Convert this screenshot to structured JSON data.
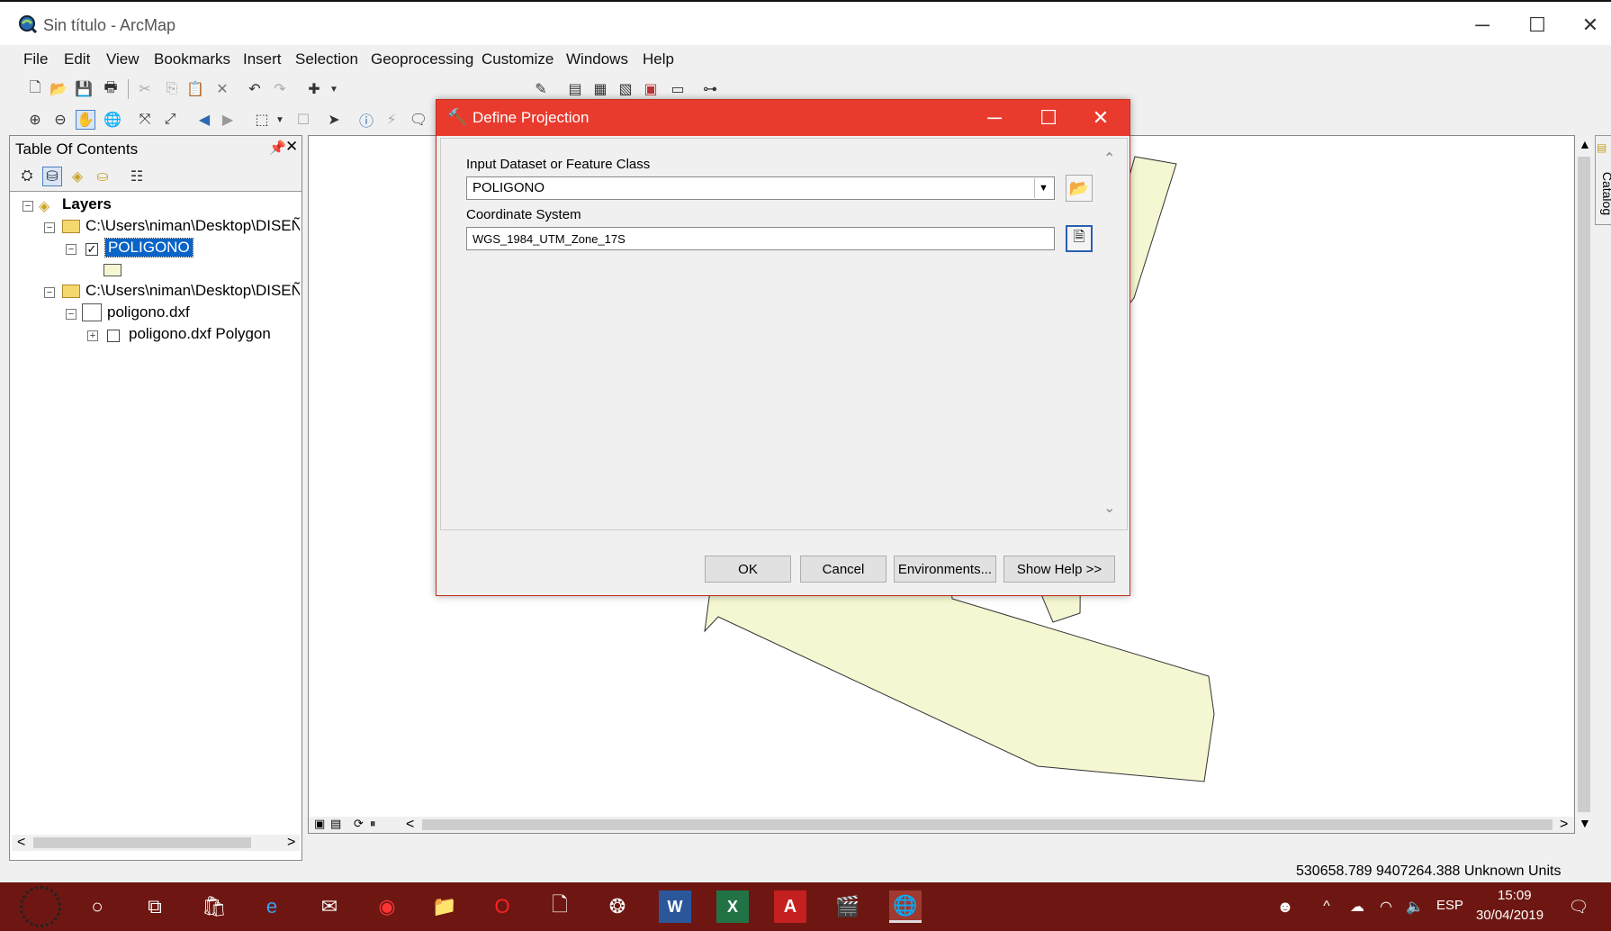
{
  "window": {
    "title": "Sin título - ArcMap"
  },
  "menu": [
    "File",
    "Edit",
    "View",
    "Bookmarks",
    "Insert",
    "Selection",
    "Geoprocessing",
    "Customize",
    "Windows",
    "Help"
  ],
  "toc": {
    "title": "Table Of Contents",
    "tree": {
      "root": "Layers",
      "folder1": "C:\\Users\\niman\\Desktop\\DISEÑO\\",
      "layer1": "POLIGONO",
      "folder2": "C:\\Users\\niman\\Desktop\\DISEÑO\\",
      "dxf": "poligono.dxf",
      "dxf_polygon": "poligono.dxf Polygon"
    }
  },
  "side_tab": "Catalog",
  "dialog": {
    "title": "Define Projection",
    "input_label": "Input Dataset or Feature Class",
    "input_value": "POLIGONO",
    "cs_label": "Coordinate System",
    "cs_value": "WGS_1984_UTM_Zone_17S",
    "buttons": {
      "ok": "OK",
      "cancel": "Cancel",
      "env": "Environments...",
      "help": "Show Help >>"
    }
  },
  "status": {
    "coords": "530658.789  9407264.388 Unknown Units"
  },
  "taskbar": {
    "lang": "ESP",
    "time": "15:09",
    "date": "30/04/2019"
  },
  "colors": {
    "dialog_title": "#e83b2e",
    "polygon_fill": "#f5f7d2",
    "taskbar": "#6e1712",
    "selection": "#0a64c8"
  }
}
